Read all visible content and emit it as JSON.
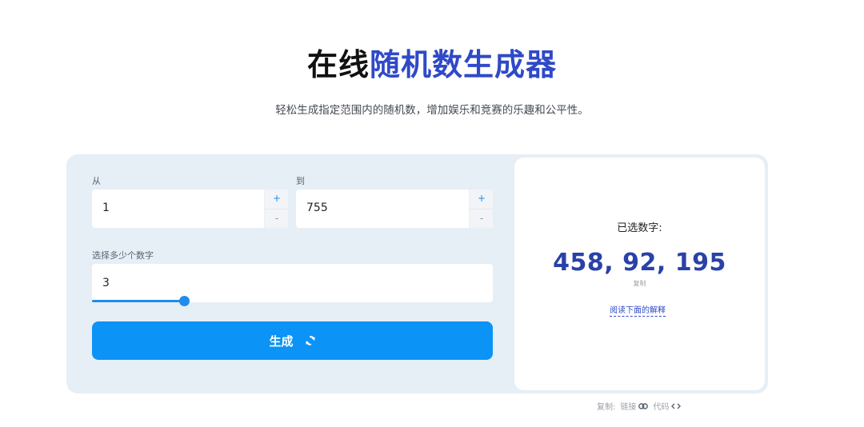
{
  "header": {
    "title_part1": "在线",
    "title_part2": "随机数生成器",
    "subtitle": "轻松生成指定范围内的随机数，增加娱乐和竞赛的乐趣和公平性。"
  },
  "form": {
    "from_label": "从",
    "from_value": "1",
    "to_label": "到",
    "to_value": "755",
    "stepper_plus": "+",
    "stepper_minus": "-",
    "count_label": "选择多少个数字",
    "count_value": "3",
    "slider_fraction": 0.23,
    "generate_label": "生成"
  },
  "result": {
    "label": "已选数字:",
    "numbers": "458, 92, 195",
    "copy_label": "复制",
    "explain_link": "阅读下面的解释"
  },
  "footer": {
    "copy_label": "复制:",
    "link_label": "链接",
    "code_label": "代码"
  },
  "colors": {
    "accent": "#0b93f6",
    "title_blue": "#2f49c8",
    "result_blue": "#2a41a8",
    "card_bg": "#e6eef6"
  }
}
